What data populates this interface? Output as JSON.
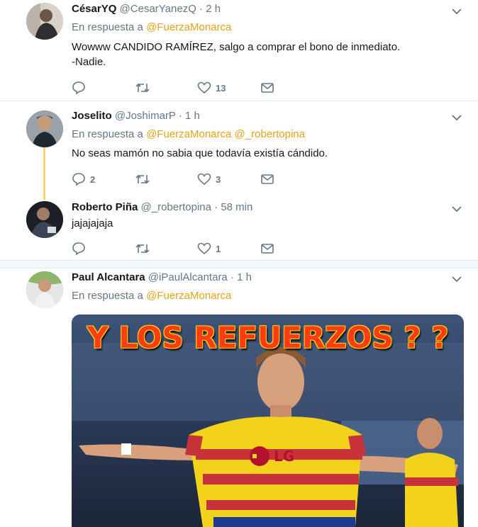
{
  "tweets": [
    {
      "name": "CésarYQ",
      "handle": "@CesarYanezQ",
      "time": "2 h",
      "reply_prefix": "En respuesta a",
      "reply_to": [
        "@FuerzaMonarca"
      ],
      "text_lines": [
        "Wowww CANDIDO RAMÍREZ, salgo a comprar el bono de inmediato.",
        "-Nadie."
      ],
      "replies": "",
      "retweets": "",
      "likes": "13"
    },
    {
      "name": "Joselito",
      "handle": "@JoshimarP",
      "time": "1 h",
      "reply_prefix": "En respuesta a",
      "reply_to": [
        "@FuerzaMonarca",
        "@_robertopina"
      ],
      "text_lines": [
        "No seas mamón no sabia que todavía existía cándido."
      ],
      "replies": "2",
      "retweets": "",
      "likes": "3"
    },
    {
      "name": "Roberto Piña",
      "handle": "@_robertopina",
      "time": "58 min",
      "text_lines": [
        "jajajajaja"
      ],
      "replies": "",
      "retweets": "",
      "likes": "1"
    },
    {
      "name": "Paul Alcantara",
      "handle": "@iPaulAlcantara",
      "time": "1 h",
      "reply_prefix": "En respuesta a",
      "reply_to": [
        "@FuerzaMonarca"
      ],
      "media_caption": "Y LOS REFUERZOS ? ?",
      "jersey_sponsor": "LG"
    }
  ],
  "dot": "·",
  "colors": {
    "link": "#e0a51c",
    "muted": "#657786",
    "thread_line": "#f5d26b",
    "separator": "#e6ecf0"
  },
  "icons": [
    "reply-icon",
    "retweet-icon",
    "like-icon",
    "dm-icon",
    "chevron-down-icon"
  ]
}
